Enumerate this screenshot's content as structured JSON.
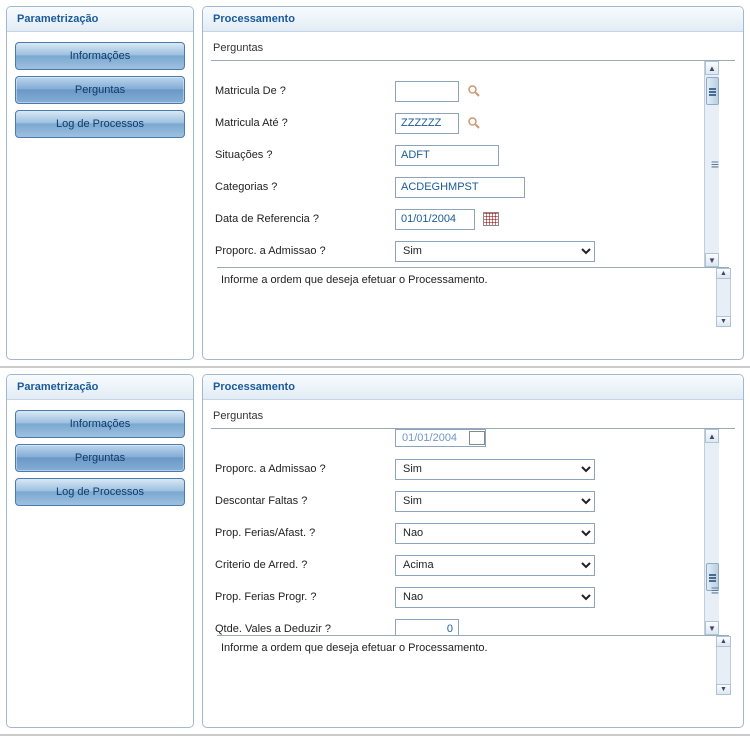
{
  "sidebar": {
    "title": "Parametrização",
    "items": [
      {
        "label": "Informações"
      },
      {
        "label": "Perguntas"
      },
      {
        "label": "Log de Processos"
      }
    ]
  },
  "content": {
    "title": "Processamento",
    "section": "Perguntas",
    "help": "Informe a ordem que deseja efetuar o Processamento."
  },
  "form1": {
    "matricula_de": {
      "label": "Matricula De ?",
      "value": ""
    },
    "matricula_ate": {
      "label": "Matricula Até ?",
      "value": "ZZZZZZ"
    },
    "situacoes": {
      "label": "Situações ?",
      "value": "ADFT"
    },
    "categorias": {
      "label": "Categorias ?",
      "value": "ACDEGHMPST"
    },
    "data_ref": {
      "label": "Data de Referencia ?",
      "value": "01/01/2004"
    },
    "proporc_admissao": {
      "label": "Proporc. a Admissao ?",
      "value": "Sim"
    }
  },
  "form2": {
    "peek_date": "01/01/2004",
    "proporc_admissao": {
      "label": "Proporc. a Admissao ?",
      "value": "Sim"
    },
    "descontar_faltas": {
      "label": "Descontar Faltas ?",
      "value": "Sim"
    },
    "prop_ferias_afast": {
      "label": "Prop. Ferias/Afast. ?",
      "value": "Nao"
    },
    "criterio_arred": {
      "label": "Criterio de Arred. ?",
      "value": "Acima"
    },
    "prop_ferias_progr": {
      "label": "Prop. Ferias Progr. ?",
      "value": "Nao"
    },
    "qtde_vales": {
      "label": "Qtde. Vales a Deduzir ?",
      "value": "0"
    }
  }
}
